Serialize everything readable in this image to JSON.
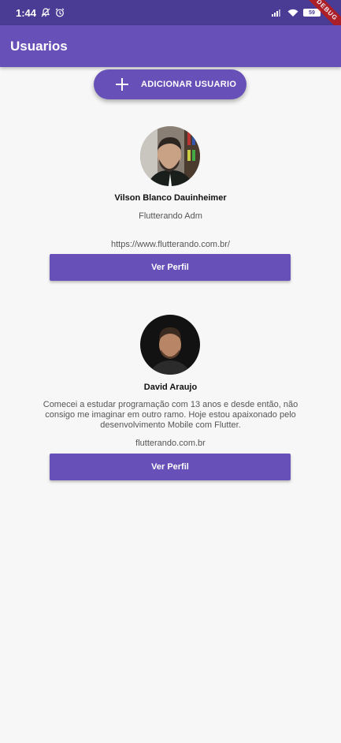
{
  "status_bar": {
    "time": "1:44",
    "battery": "59"
  },
  "debug_banner": "DEBUG",
  "app_bar": {
    "title": "Usuarios"
  },
  "add_button": {
    "label": "ADICIONAR USUARIO",
    "icon": "plus-icon"
  },
  "users": [
    {
      "name": "Vilson Blanco Dauinheimer",
      "bio": "Flutterando Adm",
      "site": "https://www.flutterando.com.br/",
      "button_label": "Ver Perfil"
    },
    {
      "name": "David Araujo",
      "bio": "Comecei a estudar programação com 13 anos e desde então, não consigo me imaginar em outro ramo. Hoje estou apaixonado pelo desenvolvimento Mobile com Flutter.",
      "site": "flutterando.com.br",
      "button_label": "Ver Perfil"
    }
  ],
  "colors": {
    "primary": "#6750b8",
    "status_bar": "#4a3b94",
    "background": "#f7f7f7"
  }
}
